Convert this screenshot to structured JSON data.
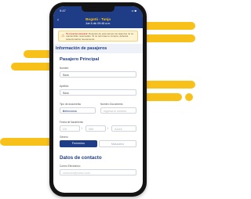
{
  "colors": {
    "accent": "#f7c11a",
    "brand": "#1f3c86",
    "warning": "#e07b10"
  },
  "status_bar": {
    "time": "9:47",
    "icons": "•• ■"
  },
  "header": {
    "back_icon": "chevron-left-icon",
    "route": "Bogotá - Tunja",
    "date": "Jue 6 dic 09:48 a.m."
  },
  "notice": {
    "icon": "warning-icon",
    "bold": "Tu reserva vencerá:",
    "text": "Después de este tiempo los asientos no se mantendrán reservados. Si no terminas tu compra, deberás seleccionarlos nuevamente."
  },
  "section_title": "Información de pasajeros",
  "passenger": {
    "title": "Pasajero Principal",
    "first_name_label": "Nombre",
    "first_name_value": "Sxxx",
    "last_name_label": "Apellido",
    "last_name_value": "Sxxx",
    "doc_type_label": "Tipo de documento",
    "doc_type_value": "Selecciona",
    "doc_number_label": "Número Documento",
    "doc_number_placeholder": "Ingresa tu número",
    "birth_label": "Fecha de Nacimiento",
    "birth_day": "DD",
    "birth_month": "MM",
    "birth_year": "AAAA",
    "gender_label": "Género",
    "gender_female": "Femenino",
    "gender_male": "Masculino"
  },
  "contact": {
    "title": "Datos de contacto",
    "email_label": "Correo Electrónico",
    "email_value": "xxxxxxxx@xxxxx.com"
  }
}
